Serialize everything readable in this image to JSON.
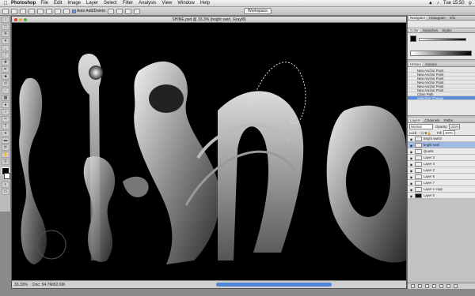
{
  "menubar": {
    "apple": "",
    "app": "Photoshop",
    "items": [
      "File",
      "Edit",
      "Image",
      "Layer",
      "Select",
      "Filter",
      "Analysis",
      "View",
      "Window",
      "Help"
    ],
    "clock": "Tue 15:50"
  },
  "options": {
    "auto_add_delete": "Auto Add/Delete",
    "workspace": "Workspace"
  },
  "document": {
    "title": "SHINE.psd @ 33.3% (bright swirl, Gray/8)",
    "zoom": "33.33%",
    "doc_info": "Doc: 54.7M/82.6M"
  },
  "panels": {
    "navigator_tabs": [
      "Navigator",
      "Histogram",
      "Info"
    ],
    "color_tabs": [
      "Color",
      "Swatches",
      "Styles"
    ],
    "history_tabs": [
      "History",
      "Actions"
    ],
    "history_items": [
      "New Anchor Point",
      "New Anchor Point",
      "New Anchor Point",
      "New Anchor Point",
      "New Anchor Point",
      "New Anchor Point",
      "Close Path",
      "Selection Change"
    ],
    "layers_tabs": [
      "Layers",
      "Channels",
      "Paths"
    ],
    "blend_mode": "Normal",
    "opacity_label": "Opacity:",
    "opacity": "100%",
    "lock_label": "Lock:",
    "fill_label": "Fill:",
    "fill": "100%",
    "layers": [
      {
        "name": "Bright swirl3",
        "selected": false,
        "dark": false
      },
      {
        "name": "bright swirl",
        "selected": true,
        "dark": false
      },
      {
        "name": "Quarst",
        "selected": false,
        "dark": false
      },
      {
        "name": "Layer 3",
        "selected": false,
        "dark": false
      },
      {
        "name": "Layer 4",
        "selected": false,
        "dark": false
      },
      {
        "name": "Layer 2",
        "selected": false,
        "dark": false
      },
      {
        "name": "Layer 5",
        "selected": false,
        "dark": false
      },
      {
        "name": "Layer 7",
        "selected": false,
        "dark": false
      },
      {
        "name": "Layer 1 copy",
        "selected": false,
        "dark": false
      },
      {
        "name": "Layer 0",
        "selected": false,
        "dark": true
      }
    ]
  }
}
